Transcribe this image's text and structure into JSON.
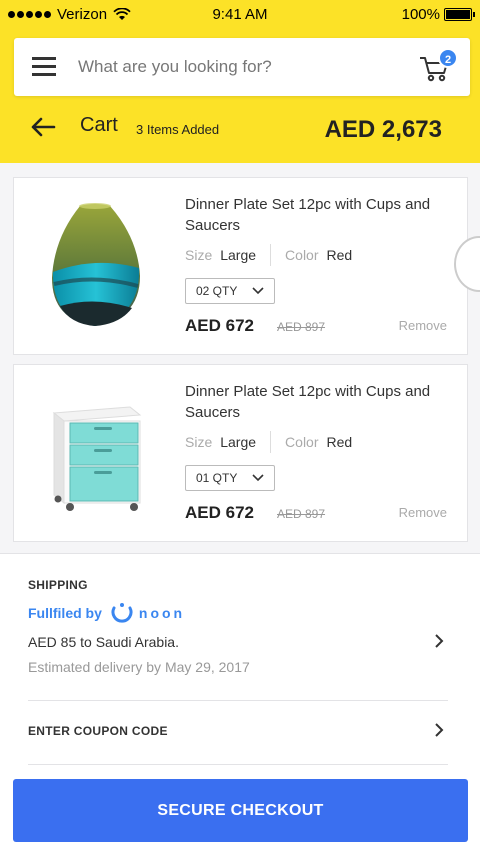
{
  "status_bar": {
    "carrier": "Verizon",
    "time": "9:41 AM",
    "battery": "100%"
  },
  "header": {
    "search_placeholder": "What are you looking for?",
    "cart_count": "2",
    "title": "Cart",
    "items_added": "3 Items Added",
    "total": "AED 2,673"
  },
  "cart_items": [
    {
      "title": "Dinner Plate Set 12pc with Cups and Saucers",
      "size_label": "Size",
      "size": "Large",
      "color_label": "Color",
      "color": "Red",
      "qty": "02 QTY",
      "price": "AED 672",
      "old_price": "AED 897",
      "remove": "Remove",
      "image_icon": "glass-vase-image"
    },
    {
      "title": "Dinner Plate Set 12pc with Cups and Saucers",
      "size_label": "Size",
      "size": "Large",
      "color_label": "Color",
      "color": "Red",
      "qty": "01 QTY",
      "price": "AED 672",
      "old_price": "AED 897",
      "remove": "Remove",
      "image_icon": "file-cabinet-image"
    }
  ],
  "shipping": {
    "label": "SHIPPING",
    "fulfilled_by": "Fullfiled by",
    "brand": "noon",
    "price_text": "AED 85 to Saudi Arabia.",
    "estimate": "Estimated delivery by May 29, 2017"
  },
  "coupon": {
    "label": "ENTER COUPON CODE"
  },
  "checkout": {
    "label": "SECURE CHECKOUT"
  },
  "colors": {
    "header_yellow": "#fce227",
    "accent_blue": "#3a86f0",
    "button_blue": "#3a6ff0"
  }
}
